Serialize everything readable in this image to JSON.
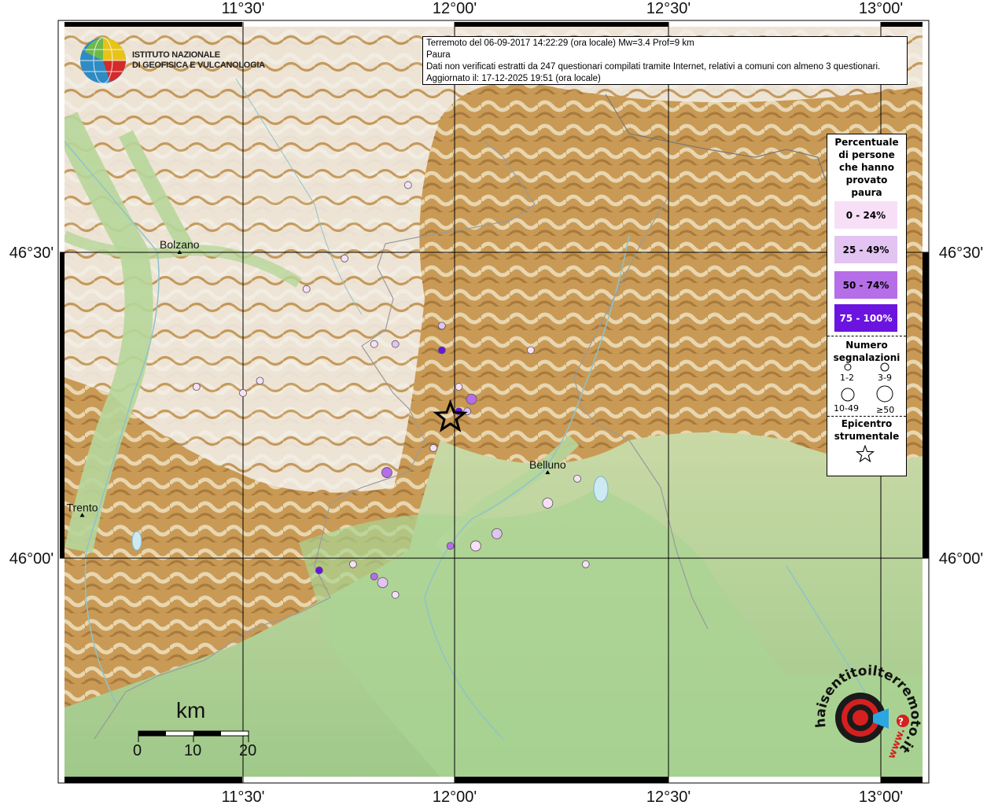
{
  "info": {
    "line1": "Terremoto del 06-09-2017 14:22:29 (ora locale) Mw=3.4 Prof=9 km",
    "line2": "Paura",
    "line3": "Dati non verificati estratti da 247 questionari compilati tramite Internet, relativi a comuni con almeno 3 questionari.",
    "line4": "Aggiornato il: 17-12-2025 19:51 (ora locale)"
  },
  "logo": {
    "line1": "ISTITUTO NAZIONALE",
    "line2": "DI GEOFISICA E VULCANOLOGIA"
  },
  "axes": {
    "lon_labels": [
      "11°30'",
      "12°00'",
      "12°30'",
      "13°00'"
    ],
    "lat_labels": [
      "46°30'",
      "46°00'"
    ]
  },
  "cities": [
    {
      "name": "Bolzano",
      "lon": 11.35,
      "lat": 46.5
    },
    {
      "name": "Trento",
      "lon": 11.12,
      "lat": 46.07
    },
    {
      "name": "Belluno",
      "lon": 12.22,
      "lat": 46.14
    }
  ],
  "legend": {
    "title_lines": [
      "Percentuale",
      "di persone",
      "che hanno",
      "provato",
      "paura"
    ],
    "classes": [
      {
        "label": "0 - 24%",
        "color": "#f7e0f7",
        "text": "#000"
      },
      {
        "label": "25 - 49%",
        "color": "#e2c3f2",
        "text": "#000"
      },
      {
        "label": "50 - 74%",
        "color": "#b56ee8",
        "text": "#000"
      },
      {
        "label": "75 - 100%",
        "color": "#6b14e0",
        "text": "#fff"
      }
    ],
    "size_title_lines": [
      "Numero",
      "segnalazioni"
    ],
    "size_labels": [
      "1-2",
      "3-9",
      "10-49",
      "≥50"
    ],
    "epi_title_lines": [
      "Epicentro",
      "strumentale"
    ]
  },
  "scale": {
    "title": "km",
    "labels": [
      "0",
      "10",
      "20"
    ]
  },
  "watermark": {
    "text": "haisentitoilterremoto.it",
    "www": "www."
  },
  "epicenter": {
    "lon": 11.99,
    "lat": 46.23
  },
  "chart_data": {
    "type": "scatter",
    "title": "Paura",
    "xlabel": "",
    "ylabel": "",
    "xlim": [
      11.0,
      13.05
    ],
    "ylim": [
      45.62,
      46.86
    ],
    "points": [
      {
        "lon": 11.89,
        "lat": 46.61,
        "class": 0,
        "size": 1
      },
      {
        "lon": 11.74,
        "lat": 46.49,
        "class": 0,
        "size": 1
      },
      {
        "lon": 11.65,
        "lat": 46.44,
        "class": 0,
        "size": 1
      },
      {
        "lon": 11.97,
        "lat": 46.38,
        "class": 1,
        "size": 1
      },
      {
        "lon": 11.86,
        "lat": 46.35,
        "class": 1,
        "size": 1
      },
      {
        "lon": 11.81,
        "lat": 46.35,
        "class": 0,
        "size": 1
      },
      {
        "lon": 11.97,
        "lat": 46.34,
        "class": 3,
        "size": 1
      },
      {
        "lon": 12.18,
        "lat": 46.34,
        "class": 0,
        "size": 1
      },
      {
        "lon": 11.54,
        "lat": 46.29,
        "class": 0,
        "size": 1
      },
      {
        "lon": 11.5,
        "lat": 46.27,
        "class": 0,
        "size": 1
      },
      {
        "lon": 11.39,
        "lat": 46.28,
        "class": 0,
        "size": 1
      },
      {
        "lon": 12.01,
        "lat": 46.28,
        "class": 0,
        "size": 1
      },
      {
        "lon": 12.04,
        "lat": 46.26,
        "class": 2,
        "size": 2
      },
      {
        "lon": 12.01,
        "lat": 46.24,
        "class": 3,
        "size": 1
      },
      {
        "lon": 12.03,
        "lat": 46.24,
        "class": 1,
        "size": 1
      },
      {
        "lon": 11.95,
        "lat": 46.18,
        "class": 0,
        "size": 1
      },
      {
        "lon": 11.84,
        "lat": 46.14,
        "class": 2,
        "size": 2
      },
      {
        "lon": 12.29,
        "lat": 46.13,
        "class": 0,
        "size": 1
      },
      {
        "lon": 12.22,
        "lat": 46.09,
        "class": 0,
        "size": 2
      },
      {
        "lon": 12.1,
        "lat": 46.04,
        "class": 1,
        "size": 2
      },
      {
        "lon": 11.99,
        "lat": 46.02,
        "class": 2,
        "size": 1
      },
      {
        "lon": 12.05,
        "lat": 46.02,
        "class": 0,
        "size": 2
      },
      {
        "lon": 11.68,
        "lat": 45.98,
        "class": 3,
        "size": 1
      },
      {
        "lon": 11.81,
        "lat": 45.97,
        "class": 2,
        "size": 1
      },
      {
        "lon": 11.83,
        "lat": 45.96,
        "class": 1,
        "size": 2
      },
      {
        "lon": 11.76,
        "lat": 45.99,
        "class": 0,
        "size": 1
      },
      {
        "lon": 12.31,
        "lat": 45.99,
        "class": 0,
        "size": 1
      },
      {
        "lon": 11.86,
        "lat": 45.94,
        "class": 0,
        "size": 1
      }
    ]
  }
}
